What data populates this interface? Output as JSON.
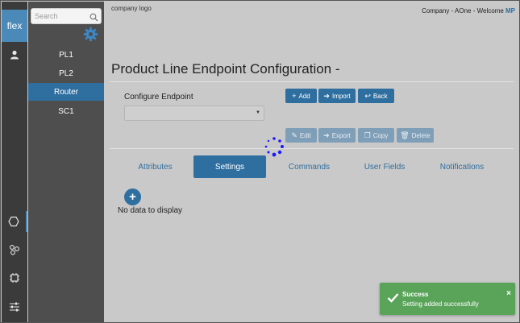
{
  "brand": {
    "label": "flex"
  },
  "rail": {
    "icons": [
      "user-icon",
      "hexagon-icon",
      "network-icon",
      "chip-icon",
      "sliders-icon"
    ],
    "active": "hexagon-icon"
  },
  "nav": {
    "search_placeholder": "Search",
    "items": [
      {
        "label": "PL1"
      },
      {
        "label": "PL2"
      },
      {
        "label": "Router",
        "active": true
      },
      {
        "label": "SC1"
      }
    ]
  },
  "header": {
    "logo_text": "company logo",
    "welcome_prefix": "Company - AOne - Welcome ",
    "user_initials": "MP"
  },
  "page": {
    "title": "Product Line Endpoint Configuration -",
    "configure_label": "Configure Endpoint",
    "select_value": ""
  },
  "toolbar": {
    "add": "Add",
    "import": "Import",
    "back": "Back",
    "edit": "Edit",
    "export": "Export",
    "copy": "Copy",
    "delete": "Delete"
  },
  "tabs": [
    {
      "label": "Attributes"
    },
    {
      "label": "Settings",
      "active": true
    },
    {
      "label": "Commands"
    },
    {
      "label": "User Fields"
    },
    {
      "label": "Notifications"
    }
  ],
  "content": {
    "empty_message": "No data to display"
  },
  "toast": {
    "title": "Success",
    "message": "Setting added successfully",
    "close": "×"
  },
  "colors": {
    "accent": "#2f6fa0",
    "success": "#5aa45a",
    "rail": "#3b3b3b",
    "nav": "#4e4e4e",
    "background": "#c9c9c9"
  }
}
